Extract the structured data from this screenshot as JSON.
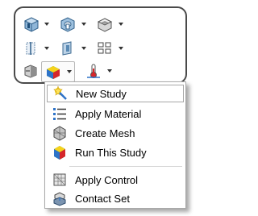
{
  "toolbar": {
    "rows": [
      [
        {
          "icon": "part-icon"
        },
        {
          "icon": "hole-wizard-icon"
        },
        {
          "icon": "shell-icon"
        }
      ],
      [
        {
          "icon": "split-line-icon"
        },
        {
          "icon": "reference-geometry-icon"
        },
        {
          "icon": "pattern-icon"
        }
      ],
      [
        {
          "icon": "linear-static-icon"
        },
        {
          "icon": "simulation-study-icon",
          "active": true
        },
        {
          "icon": "thermal-icon"
        }
      ]
    ]
  },
  "menu": {
    "items": [
      {
        "label": "New Study",
        "icon": "new-study-icon",
        "highlighted": true
      },
      {
        "label": "Apply Material",
        "icon": "apply-material-icon"
      },
      {
        "label": "Create Mesh",
        "icon": "create-mesh-icon"
      },
      {
        "label": "Run This Study",
        "icon": "run-study-icon"
      },
      {
        "label": "Apply Control",
        "icon": "apply-control-icon"
      },
      {
        "label": "Contact Set",
        "icon": "contact-set-icon"
      }
    ]
  }
}
